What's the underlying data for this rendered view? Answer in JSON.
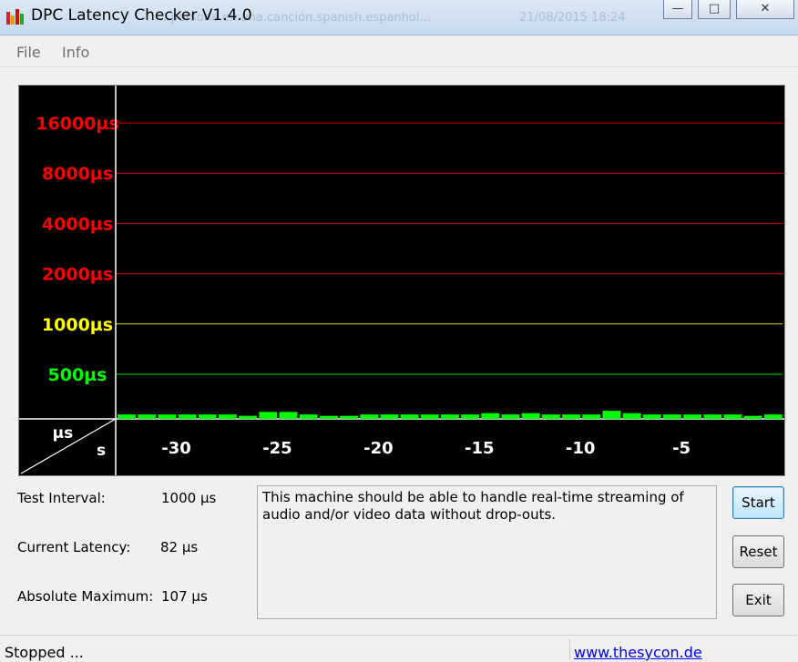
{
  "window": {
    "title": "DPC Latency Checker V1.4.0",
    "minimize_label": "—",
    "maximize_label": "□",
    "close_label": "✕",
    "background_ghost_texts": [
      "...persona.en.una.canción.spanish.espanhol...",
      "21/08/2015 18:24"
    ]
  },
  "menu": {
    "file_label": "File",
    "info_label": "Info"
  },
  "chart_data": {
    "type": "bar",
    "y_scale": "log",
    "ylabel": "µs",
    "xlabel": "s",
    "y_gridlines": [
      {
        "label": "16000µs",
        "value": 16000,
        "color": "#ff0000"
      },
      {
        "label": "8000µs",
        "value": 8000,
        "color": "#ff0000"
      },
      {
        "label": "4000µs",
        "value": 4000,
        "color": "#ff0000"
      },
      {
        "label": "2000µs",
        "value": 2000,
        "color": "#ff0000"
      },
      {
        "label": "1000µs",
        "value": 1000,
        "color": "#ffff00"
      },
      {
        "label": "500µs",
        "value": 500,
        "color": "#00ff00"
      }
    ],
    "x_ticks": [
      "-30",
      "-25",
      "-20",
      "-15",
      "-10",
      "-5"
    ],
    "x_tick_values": [
      -30,
      -25,
      -20,
      -15,
      -10,
      -5
    ],
    "x_range": [
      -33,
      0
    ],
    "bar_color": "#00ff00",
    "values": [
      85,
      85,
      85,
      85,
      85,
      85,
      80,
      95,
      95,
      85,
      80,
      80,
      85,
      85,
      85,
      85,
      85,
      85,
      90,
      85,
      90,
      85,
      85,
      85,
      100,
      90,
      85,
      85,
      85,
      85,
      85,
      80,
      85,
      85
    ]
  },
  "stats": {
    "test_interval_label": "Test Interval:",
    "test_interval_value": "1000 µs",
    "current_latency_label": "Current Latency:",
    "current_latency_value": "82 µs",
    "absolute_maximum_label": "Absolute Maximum:",
    "absolute_maximum_value": "107 µs"
  },
  "message": "This machine should be able to handle real-time streaming of audio and/or video data without drop-outs.",
  "buttons": {
    "start": "Start",
    "reset": "Reset",
    "exit": "Exit"
  },
  "status": {
    "state": "Stopped ...",
    "link": "www.thesycon.de"
  }
}
